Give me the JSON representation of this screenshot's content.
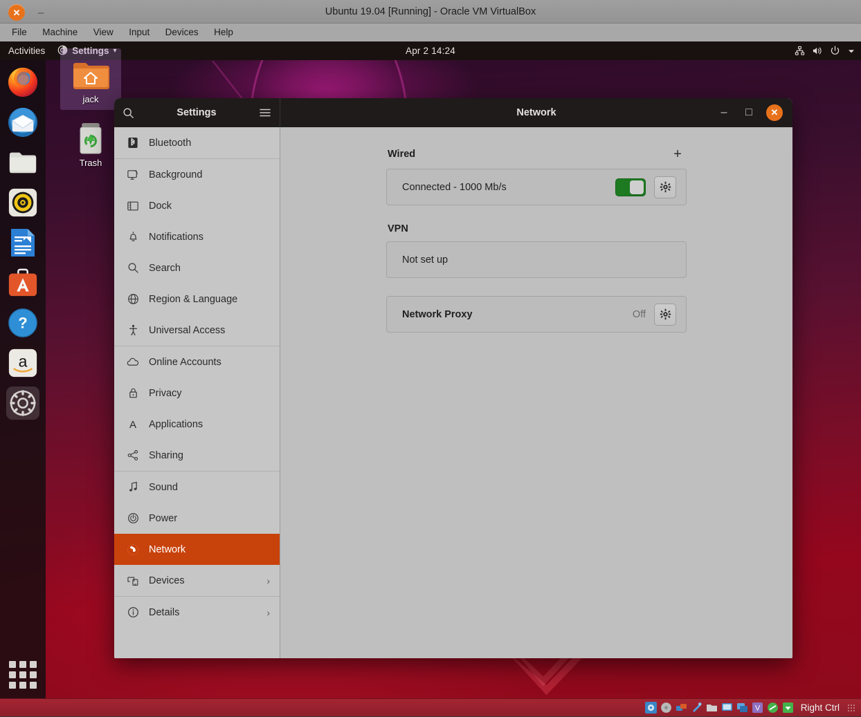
{
  "vbox": {
    "title": "Ubuntu 19.04 [Running] - Oracle VM VirtualBox",
    "close_glyph": "✕",
    "minimize_glyph": "–",
    "menus": [
      "File",
      "Machine",
      "View",
      "Input",
      "Devices",
      "Help"
    ],
    "status": {
      "host_key": "Right Ctrl",
      "icons": [
        "hard-disk-icon",
        "optical-disk-icon",
        "network-icon",
        "usb-icon",
        "shared-folder-icon",
        "display-icon",
        "clipboard-icon",
        "video-capture-icon",
        "mouse-integration-icon",
        "keyboard-icon"
      ]
    }
  },
  "desktop": {
    "top_panel": {
      "activities": "Activities",
      "app_name": "Settings",
      "app_icon": "settings-app-icon",
      "app_menu_arrow": "▾",
      "clock": "Apr 2  14:24",
      "status_icons": [
        "network-wired-icon",
        "volume-icon",
        "power-icon",
        "chevron-down-icon"
      ]
    },
    "dock": {
      "items": [
        {
          "name": "firefox",
          "label": "Firefox"
        },
        {
          "name": "thunderbird",
          "label": "Thunderbird Mail"
        },
        {
          "name": "files",
          "label": "Files"
        },
        {
          "name": "rhythmbox",
          "label": "Rhythmbox"
        },
        {
          "name": "libreoffice-writer",
          "label": "LibreOffice Writer"
        },
        {
          "name": "ubuntu-software",
          "label": "Ubuntu Software"
        },
        {
          "name": "help",
          "label": "Help"
        },
        {
          "name": "amazon",
          "label": "Amazon"
        },
        {
          "name": "settings",
          "label": "Settings",
          "active": true
        }
      ],
      "show_applications": "Show Applications"
    },
    "icons": [
      {
        "name": "home-folder",
        "label": "jack",
        "selected": true
      },
      {
        "name": "trash",
        "label": "Trash",
        "selected": false
      }
    ]
  },
  "settings_window": {
    "sidebar_title": "Settings",
    "page_title": "Network",
    "search_icon": "search-icon",
    "menu_icon": "hamburger-menu-icon",
    "window_controls": {
      "minimize": "–",
      "maximize": "□",
      "close": "✕"
    },
    "sidebar": {
      "groups": [
        {
          "items": [
            {
              "label": "Bluetooth",
              "icon": "bluetooth-icon"
            }
          ]
        },
        {
          "items": [
            {
              "label": "Background",
              "icon": "background-icon"
            },
            {
              "label": "Dock",
              "icon": "dock-icon"
            },
            {
              "label": "Notifications",
              "icon": "bell-icon"
            },
            {
              "label": "Search",
              "icon": "search-icon"
            },
            {
              "label": "Region & Language",
              "icon": "globe-icon"
            },
            {
              "label": "Universal Access",
              "icon": "accessibility-icon"
            }
          ]
        },
        {
          "items": [
            {
              "label": "Online Accounts",
              "icon": "cloud-icon"
            },
            {
              "label": "Privacy",
              "icon": "lock-icon"
            },
            {
              "label": "Applications",
              "icon": "applications-icon"
            },
            {
              "label": "Sharing",
              "icon": "share-icon"
            }
          ]
        },
        {
          "items": [
            {
              "label": "Sound",
              "icon": "music-note-icon"
            },
            {
              "label": "Power",
              "icon": "power-icon"
            },
            {
              "label": "Network",
              "icon": "network-globe-icon",
              "selected": true
            },
            {
              "label": "Devices",
              "icon": "devices-icon",
              "chevron": "›"
            }
          ]
        },
        {
          "items": [
            {
              "label": "Details",
              "icon": "info-icon",
              "chevron": "›"
            }
          ]
        }
      ]
    },
    "network_page": {
      "wired": {
        "title": "Wired",
        "add_button": "+",
        "connection_label": "Connected - 1000 Mb/s",
        "toggle_state": "on",
        "settings_icon": "gear-icon"
      },
      "vpn": {
        "title": "VPN",
        "status_label": "Not set up"
      },
      "proxy": {
        "title": "Network Proxy",
        "state": "Off",
        "settings_icon": "gear-icon"
      }
    }
  },
  "annotation": {
    "callout": {
      "type": "magnifier-callout",
      "border_color": "#ffd21f",
      "background": "#ffffff",
      "toggle_state": "on",
      "toggle_color": "#3cba3c",
      "gear_icon": "gear-icon",
      "points_at": "wired-connection-toggle"
    }
  },
  "colors": {
    "accent_orange": "#c8420b",
    "toggle_green": "#1d7a20",
    "callout_yellow": "#ffd21f",
    "panel_dark": "#19110f",
    "settings_bg": "#bfbfbf",
    "sidebar_bg": "#c6c6c6"
  }
}
